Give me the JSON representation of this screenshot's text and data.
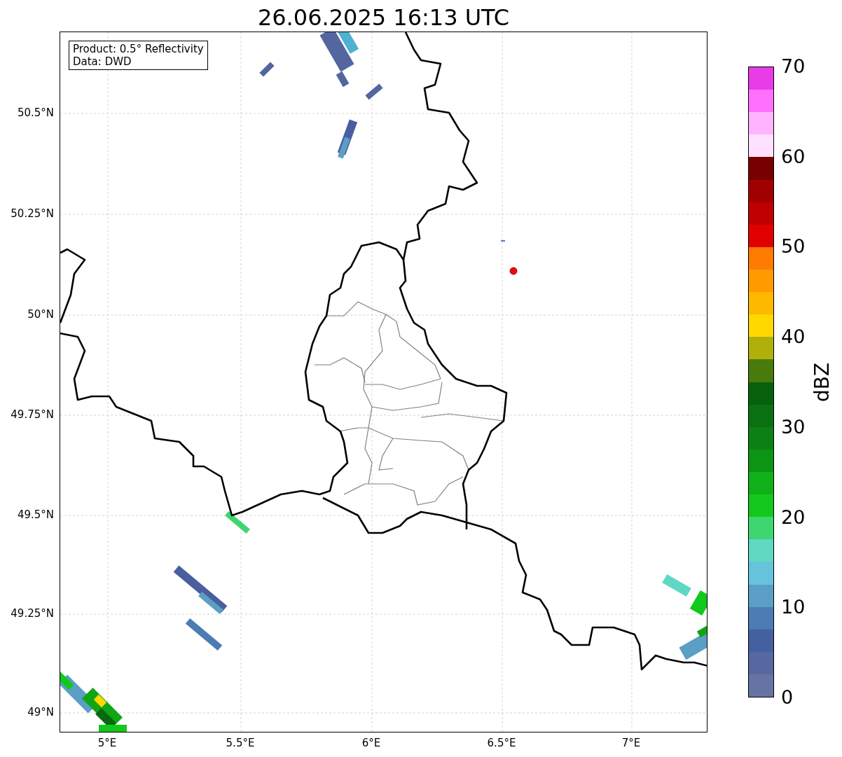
{
  "title": "26.06.2025 16:13 UTC",
  "info_box": {
    "lines": [
      "Product: 0.5° Reflectivity",
      "Data: DWD"
    ]
  },
  "y_ticks": [
    "50.5°N",
    "50.25°N",
    "50°N",
    "49.75°N",
    "49.5°N",
    "49.25°N",
    "49°N"
  ],
  "x_ticks": [
    "5°E",
    "5.5°E",
    "6°E",
    "6.5°E",
    "7°E"
  ],
  "colorbar": {
    "label": "dBZ",
    "ticks": [
      "70",
      "60",
      "50",
      "40",
      "30",
      "20",
      "10",
      "0"
    ],
    "bins": [
      {
        "color": "#e83ce8"
      },
      {
        "color": "#ff70ff"
      },
      {
        "color": "#ffb4ff"
      },
      {
        "color": "#ffe0ff"
      },
      {
        "color": "#780000"
      },
      {
        "color": "#a00000"
      },
      {
        "color": "#c00000"
      },
      {
        "color": "#e00000"
      },
      {
        "color": "#ff7a00"
      },
      {
        "color": "#ff9a00"
      },
      {
        "color": "#ffb800"
      },
      {
        "color": "#ffd800"
      },
      {
        "color": "#b0b00c"
      },
      {
        "color": "#487a0c"
      },
      {
        "color": "#06600c"
      },
      {
        "color": "#0a7012"
      },
      {
        "color": "#0c8014"
      },
      {
        "color": "#0c9414"
      },
      {
        "color": "#10b01a"
      },
      {
        "color": "#12c91b"
      },
      {
        "color": "#3ed670"
      },
      {
        "color": "#5fd8c2"
      },
      {
        "color": "#67c3dc"
      },
      {
        "color": "#5b9ec6"
      },
      {
        "color": "#4d7bb4"
      },
      {
        "color": "#4460a0"
      },
      {
        "color": "#5768a0"
      },
      {
        "color": "#6673a5"
      }
    ]
  }
}
